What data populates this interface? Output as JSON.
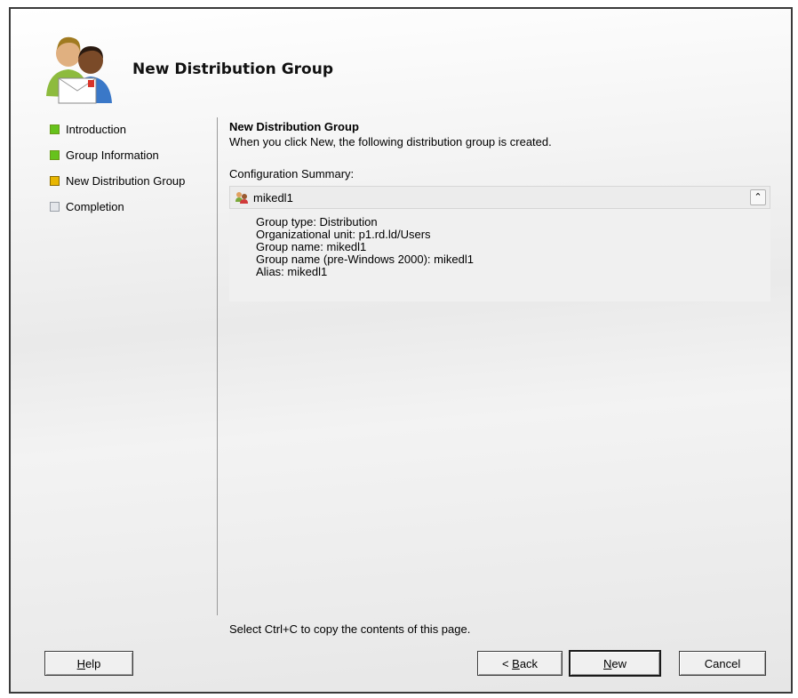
{
  "header": {
    "title": "New Distribution Group",
    "icon": "users-envelope-icon"
  },
  "steps": [
    {
      "label": "Introduction",
      "state": "done"
    },
    {
      "label": "Group Information",
      "state": "done"
    },
    {
      "label": "New Distribution Group",
      "state": "current"
    },
    {
      "label": "Completion",
      "state": "pending"
    }
  ],
  "content": {
    "title": "New Distribution Group",
    "description": "When you click New, the following distribution group is created.",
    "summary_label": "Configuration Summary:",
    "summary": {
      "name": "mikedl1",
      "lines": [
        "Group type: Distribution",
        "Organizational unit: p1.rd.ld/Users",
        "Group name: mikedl1",
        "Group name (pre-Windows 2000): mikedl1",
        "Alias: mikedl1"
      ]
    },
    "copy_hint": "Select Ctrl+C to copy the contents of this page."
  },
  "buttons": {
    "help": {
      "pre": "",
      "key": "H",
      "post": "elp"
    },
    "back": {
      "pre": "< ",
      "key": "B",
      "post": "ack"
    },
    "new": {
      "pre": "",
      "key": "N",
      "post": "ew"
    },
    "cancel": {
      "pre": "Cancel",
      "key": "",
      "post": ""
    }
  },
  "colors": {
    "step_done": "#66c21c",
    "step_current": "#e8b600",
    "step_pending": "#e4e6ea"
  }
}
